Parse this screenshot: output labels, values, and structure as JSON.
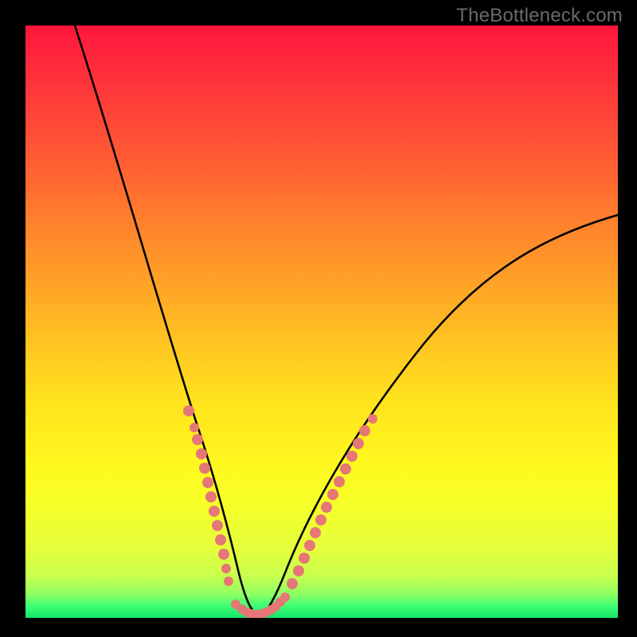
{
  "watermark": {
    "text": "TheBottleneck.com"
  },
  "chart_data": {
    "type": "line",
    "title": "",
    "xlabel": "",
    "ylabel": "",
    "xlim": [
      0,
      100
    ],
    "ylim": [
      0,
      100
    ],
    "grid": false,
    "legend": false,
    "note": "No axis ticks, tick labels, or data labels are shown in the image; values are estimated from pixel positions on a 0–100 scale.",
    "series": [
      {
        "name": "curve",
        "color": "#000000",
        "x": [
          8,
          12,
          16,
          20,
          24,
          28,
          30,
          32,
          34,
          36,
          37,
          38,
          40,
          42,
          44,
          48,
          52,
          56,
          60,
          65,
          70,
          75,
          80,
          85,
          90,
          95,
          100
        ],
        "y": [
          100,
          88,
          75,
          62,
          48,
          35,
          28,
          20,
          13,
          7,
          3,
          0,
          0,
          0,
          3,
          10,
          18,
          26,
          33,
          40,
          46,
          51,
          55,
          58,
          61,
          63,
          65
        ]
      },
      {
        "name": "left-dots",
        "color": "#e57777",
        "marker": "circle",
        "x": [
          27.5,
          28.5,
          29.0,
          29.6,
          30.2,
          30.8,
          31.3,
          31.8,
          32.3,
          32.8,
          33.3,
          33.8,
          34.3
        ],
        "y": [
          35,
          32,
          30,
          28,
          25,
          23,
          20,
          18,
          15,
          13,
          11,
          8,
          6
        ]
      },
      {
        "name": "bottom-dots",
        "color": "#e57777",
        "marker": "circle",
        "x": [
          35.5,
          36.5,
          37.3,
          38.2,
          39.1,
          39.8,
          40.6,
          41.4,
          42.3,
          43.0,
          43.8
        ],
        "y": [
          2.1,
          1.2,
          0.7,
          0.5,
          0.5,
          0.6,
          0.9,
          1.4,
          2.0,
          2.7,
          3.5
        ]
      },
      {
        "name": "right-dots",
        "color": "#e57777",
        "marker": "circle",
        "x": [
          45.0,
          46.0,
          47.0,
          48.0,
          49.0,
          50.0,
          51.0,
          52.0,
          53.0,
          54.0,
          55.0,
          56.0,
          57.0,
          58.5
        ],
        "y": [
          6,
          8,
          10,
          12,
          14,
          16,
          18,
          20,
          22,
          24,
          26,
          28,
          30,
          33
        ]
      }
    ]
  }
}
